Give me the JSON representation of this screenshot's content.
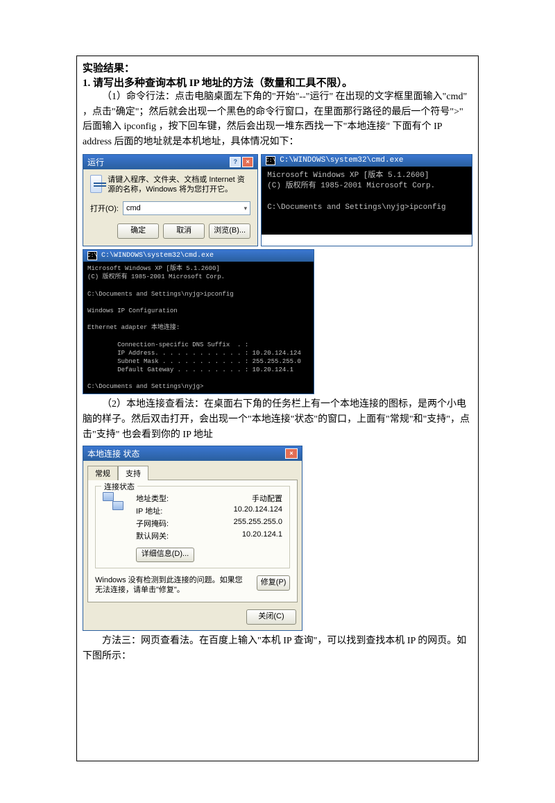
{
  "doc": {
    "section_title": "实验结果：",
    "q1_title": "1. 请写出多种查询本机 IP 地址的方法（数量和工具不限）。",
    "method1_text": "（1）命令行法：点击电脑桌面左下角的\"开始\"--\"运行\"   在出现的文字框里面输入\"cmd\"  ，点击\"确定\"；然后就会出现一个黑色的命令行窗口，在里面那行路径的最后一个符号\">\"  后面输入 ipconfig ，按下回车键，然后会出现一堆东西找一下\"本地连接\"  下面有个 IP address 后面的地址就是本机地址，具体情况如下：",
    "method2_text": "（2）本地连接查看法：在桌面右下角的任务栏上有一个本地连接的图标，是两个小电脑的样子。然后双击打开，会出现一个\"本地连接\"状态\"的窗口，上面有\"常规\"和\"支持\"，点击\"支持\"  也会看到你的 IP 地址",
    "method3_text": "方法三：网页查看法。在百度上输入\"本机 IP 查询\"，可以找到查找本机 IP 的网页。如下图所示："
  },
  "run": {
    "title": "运行",
    "help_icon": "?",
    "close_icon": "×",
    "message": "请键入程序、文件夹、文档或 Internet 资源的名称，Windows 将为您打开它。",
    "open_label": "打开(O):",
    "open_value": "cmd",
    "btn_ok": "确定",
    "btn_cancel": "取消",
    "btn_browse": "浏览(B)..."
  },
  "cmd1": {
    "title": "C:\\WINDOWS\\system32\\cmd.exe",
    "line1": "Microsoft Windows XP [版本 5.1.2600]",
    "line2": "(C) 版权所有 1985-2001 Microsoft Corp.",
    "line3": "C:\\Documents and Settings\\nyjg>ipconfig"
  },
  "cmd2": {
    "title": "C:\\WINDOWS\\system32\\cmd.exe",
    "out": "Microsoft Windows XP [版本 5.1.2600]\n(C) 版权所有 1985-2001 Microsoft Corp.\n\nC:\\Documents and Settings\\nyjg>ipconfig\n\nWindows IP Configuration\n\nEthernet adapter 本地连接:\n\n        Connection-specific DNS Suffix  . :\n        IP Address. . . . . . . . . . . . : 10.20.124.124\n        Subnet Mask . . . . . . . . . . . : 255.255.255.0\n        Default Gateway . . . . . . . . . : 10.20.124.1\n\nC:\\Documents and Settings\\nyjg>"
  },
  "conn": {
    "title": "本地连接 状态",
    "close_icon": "×",
    "tab_general": "常规",
    "tab_support": "支持",
    "group_title": "连接状态",
    "rows": {
      "type_k": "地址类型:",
      "type_v": "手动配置",
      "ip_k": "IP 地址:",
      "ip_v": "10.20.124.124",
      "mask_k": "子网掩码:",
      "mask_v": "255.255.255.0",
      "gw_k": "默认网关:",
      "gw_v": "10.20.124.1"
    },
    "detail_btn": "详细信息(D)...",
    "notice": "Windows 没有检测到此连接的问题。如果您无法连接，请单击\"修复\"。",
    "repair_btn": "修复(P)",
    "close_btn": "关闭(C)"
  }
}
